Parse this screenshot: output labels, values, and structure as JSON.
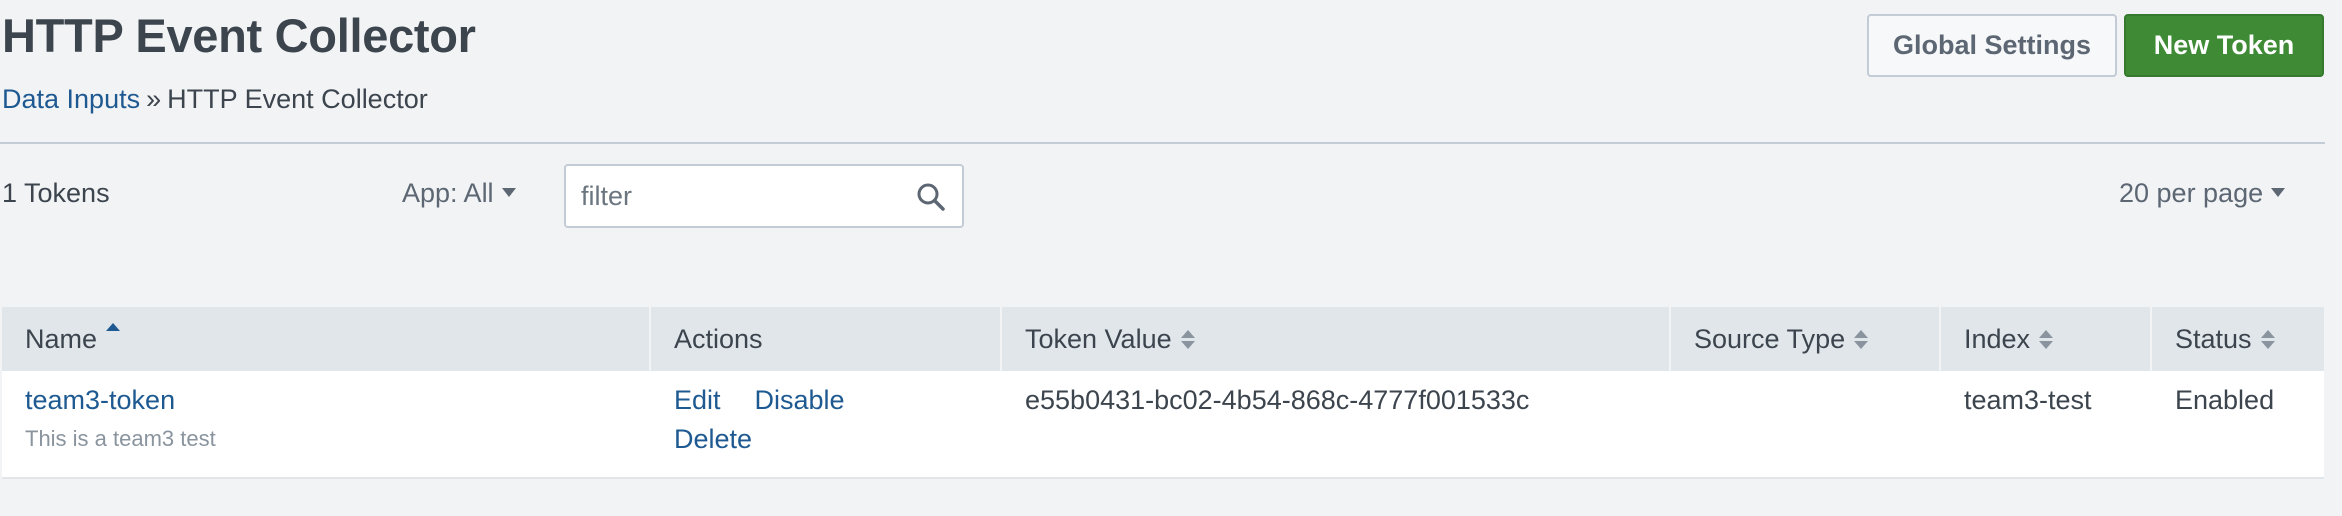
{
  "header": {
    "title": "HTTP Event Collector",
    "breadcrumb": {
      "link": "Data Inputs",
      "separator": "»",
      "current": "HTTP Event Collector"
    },
    "buttons": {
      "global_settings": "Global Settings",
      "new_token": "New Token"
    }
  },
  "controls": {
    "count": "1 Tokens",
    "app_filter": "App: All",
    "filter_placeholder": "filter",
    "filter_value": "",
    "per_page": "20 per page"
  },
  "table": {
    "columns": [
      "Name",
      "Actions",
      "Token Value",
      "Source Type",
      "Index",
      "Status"
    ],
    "rows": [
      {
        "name": "team3-token",
        "description": "This is a team3 test",
        "actions": {
          "edit": "Edit",
          "disable": "Disable",
          "delete": "Delete"
        },
        "token_value": "e55b0431-bc02-4b54-868c-4777f001533c",
        "source_type": "",
        "index": "team3-test",
        "status": "Enabled"
      }
    ]
  },
  "colors": {
    "accent_link": "#1e5a91",
    "primary_button": "#3e8a35",
    "header_bg": "#e1e6eb",
    "page_bg": "#f2f3f5"
  }
}
